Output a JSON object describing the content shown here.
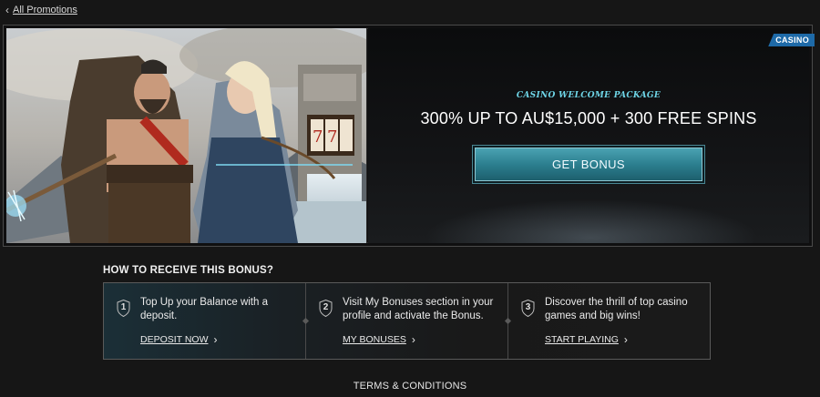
{
  "nav": {
    "back_label": "All Promotions"
  },
  "hero": {
    "badge": "CASINO",
    "kicker": "CASINO WELCOME PACKAGE",
    "headline": "300% UP TO AU$15,000 + 300 FREE SPINS",
    "cta_label": "GET BONUS",
    "image_alt": "Viking warrior and shieldmaiden with bow in front of slot machine"
  },
  "how_to": {
    "title": "HOW TO RECEIVE THIS BONUS?",
    "steps": [
      {
        "num": "1",
        "text": "Top Up your Balance with a deposit.",
        "link": "DEPOSIT NOW"
      },
      {
        "num": "2",
        "text": "Visit My Bonuses section in your profile and activate the Bonus.",
        "link": "MY BONUSES"
      },
      {
        "num": "3",
        "text": "Discover the thrill of top casino games and big wins!",
        "link": "START PLAYING"
      }
    ]
  },
  "footer": {
    "terms_label": "TERMS & CONDITIONS"
  },
  "colors": {
    "accent": "#2c7f8f",
    "kicker": "#6fd6e8",
    "badge": "#1e6aa8",
    "bg": "#161616"
  }
}
